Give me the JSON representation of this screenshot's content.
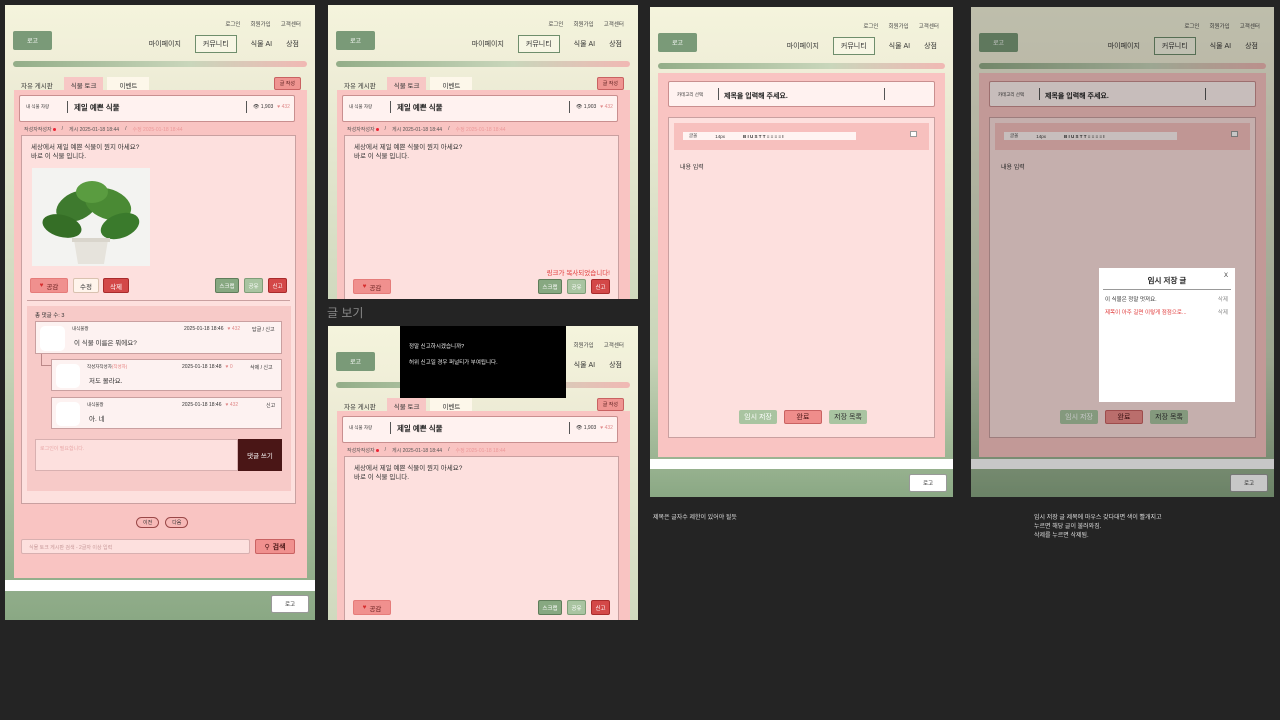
{
  "header": {
    "links": [
      "로그인",
      "회원가입",
      "고객센터"
    ],
    "logo": "로고",
    "nav": [
      "마이페이지",
      "커뮤니티",
      "식물 AI",
      "상점"
    ]
  },
  "tabs": [
    "자유 게시판",
    "식물 토크",
    "이벤트"
  ],
  "write_button": "글 작성",
  "post": {
    "category": "내 식물 자랑",
    "title": "제일 예쁜 식물",
    "views": "👁 1,903",
    "likes": "♥ 432",
    "author": "작성자작성자",
    "posted": "게시 2025-01-18 18:44",
    "modified": "수정 2025-01-18 18:44",
    "line1": "세상에서 제일 예쁜 식물이 뭔지 아세요?",
    "line2": "바로 이 식물 입니다."
  },
  "buttons": {
    "like": "공감",
    "edit": "수정",
    "delete": "삭제",
    "scrap": "스크랩",
    "share": "공유",
    "report": "신고",
    "reply_submit": "댓글 쓰기",
    "prev": "이전",
    "next": "다음",
    "search": "검색",
    "logout": "로고"
  },
  "comments": {
    "count_label": "총 댓글 수: 3",
    "items": [
      {
        "user": "내식물짱",
        "time": "2025-01-18 18:46",
        "likes": "♥ 432",
        "actions": "답글 / 신고",
        "text": "이 식물 이름은 뭐에요?"
      },
      {
        "user": "작성자작성자",
        "tag": "(작성자)",
        "time": "2025-01-18 18:48",
        "likes": "♥ 0",
        "actions": "삭제 / 신고",
        "text": "저도 몰라요."
      },
      {
        "user": "내식물짱",
        "time": "2025-01-18 18:46",
        "likes": "♥ 432",
        "actions": "신고",
        "text": "아. 네"
      }
    ],
    "input_placeholder": "로그인이 필요합니다."
  },
  "search": {
    "placeholder": "식물 토크 게시판 검색 - 2글자 이상 입력"
  },
  "copied_message": "링크가 복사되었습니다!",
  "section_label": "글 보기",
  "report_dialog": {
    "line1": "정말 신고하시겠습니까?",
    "line2": "허위 신고일 경우 퍼널티가 부여됩니다."
  },
  "write": {
    "category": "카테고리 선택",
    "title_placeholder": "제목을 입력해 주세요.",
    "toolbar_font": "글꼴",
    "toolbar_size": "14px",
    "toolbar_icons": "B I U S T T  ≡ ≡ ≡ ≡ I",
    "content_placeholder": "내용 입력",
    "temp_save": "임시 저장",
    "done": "완료",
    "saved_list": "저장 목록"
  },
  "temp_modal": {
    "title": "임시 저장 글",
    "close": "X",
    "items": [
      {
        "text": "이 식물은 정말 멋져요.",
        "action": "삭제"
      },
      {
        "text": "제목이 아주 길면 이렇게 점점으로...",
        "action": "삭제"
      }
    ]
  },
  "annotations": {
    "note1": "제목은 글자수 제한이 있어야 될듯",
    "note2_l1": "임시 저장 글 제목에 마우스 갖다대면 색이 빨개지고",
    "note2_l2": "누르면 해당 글이 불러와짐.",
    "note2_l3": "삭제를 누르면 삭제됨."
  },
  "colors": {
    "accent_pink": "#f9c4c2",
    "accent_green": "#87a881",
    "danger": "#d34848"
  }
}
